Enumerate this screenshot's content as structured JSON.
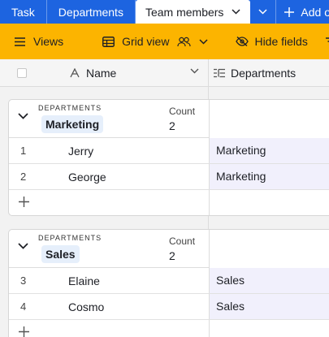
{
  "tabs": [
    {
      "label": "Task"
    },
    {
      "label": "Departments"
    },
    {
      "label": "Team members",
      "active": true
    }
  ],
  "tabbar": {
    "add_label": "Add or"
  },
  "toolbar": {
    "views_label": "Views",
    "grid_view_label": "Grid view",
    "hide_fields_label": "Hide fields"
  },
  "header": {
    "name_col": "Name",
    "departments_col": "Departments"
  },
  "groups": [
    {
      "key_label": "DEPARTMENTS",
      "value": "Marketing",
      "count_label": "Count",
      "count": "2",
      "rows": [
        {
          "num": "1",
          "name": "Jerry",
          "department": "Marketing"
        },
        {
          "num": "2",
          "name": "George",
          "department": "Marketing"
        }
      ]
    },
    {
      "key_label": "DEPARTMENTS",
      "value": "Sales",
      "count_label": "Count",
      "count": "2",
      "rows": [
        {
          "num": "3",
          "name": "Elaine",
          "department": "Sales"
        },
        {
          "num": "4",
          "name": "Cosmo",
          "department": "Sales"
        }
      ]
    }
  ],
  "colors": {
    "tabbar_bg": "#1d64e0",
    "toolbar_bg": "#fcb400",
    "group_value_bg": "#e6effb",
    "linked_cell_bg": "#f1f0fc"
  },
  "icons": [
    "chevron-down-icon",
    "plus-icon",
    "hamburger-icon",
    "grid-icon",
    "people-icon",
    "eye-slash-icon",
    "filter-icon",
    "text-field-icon",
    "linked-record-icon"
  ]
}
